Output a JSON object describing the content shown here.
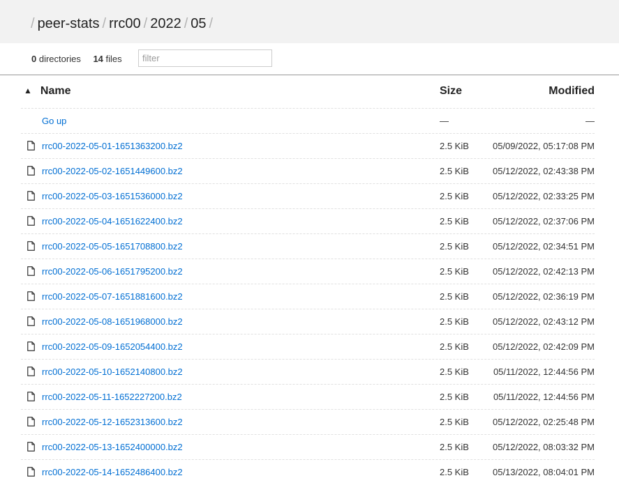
{
  "breadcrumb": {
    "separator": "/",
    "items": [
      "peer-stats",
      "rrc00",
      "2022",
      "05"
    ]
  },
  "summary": {
    "directories_count": "0",
    "directories_label": "directories",
    "files_count": "14",
    "files_label": "files"
  },
  "filter": {
    "placeholder": "filter",
    "value": ""
  },
  "columns": {
    "name": "Name",
    "size": "Size",
    "modified": "Modified",
    "sort_indicator": "▲"
  },
  "go_up": {
    "label": "Go up",
    "size": "—",
    "modified": "—"
  },
  "files": [
    {
      "name": "rrc00-2022-05-01-1651363200.bz2",
      "size": "2.5 KiB",
      "modified": "05/09/2022, 05:17:08 PM"
    },
    {
      "name": "rrc00-2022-05-02-1651449600.bz2",
      "size": "2.5 KiB",
      "modified": "05/12/2022, 02:43:38 PM"
    },
    {
      "name": "rrc00-2022-05-03-1651536000.bz2",
      "size": "2.5 KiB",
      "modified": "05/12/2022, 02:33:25 PM"
    },
    {
      "name": "rrc00-2022-05-04-1651622400.bz2",
      "size": "2.5 KiB",
      "modified": "05/12/2022, 02:37:06 PM"
    },
    {
      "name": "rrc00-2022-05-05-1651708800.bz2",
      "size": "2.5 KiB",
      "modified": "05/12/2022, 02:34:51 PM"
    },
    {
      "name": "rrc00-2022-05-06-1651795200.bz2",
      "size": "2.5 KiB",
      "modified": "05/12/2022, 02:42:13 PM"
    },
    {
      "name": "rrc00-2022-05-07-1651881600.bz2",
      "size": "2.5 KiB",
      "modified": "05/12/2022, 02:36:19 PM"
    },
    {
      "name": "rrc00-2022-05-08-1651968000.bz2",
      "size": "2.5 KiB",
      "modified": "05/12/2022, 02:43:12 PM"
    },
    {
      "name": "rrc00-2022-05-09-1652054400.bz2",
      "size": "2.5 KiB",
      "modified": "05/12/2022, 02:42:09 PM"
    },
    {
      "name": "rrc00-2022-05-10-1652140800.bz2",
      "size": "2.5 KiB",
      "modified": "05/11/2022, 12:44:56 PM"
    },
    {
      "name": "rrc00-2022-05-11-1652227200.bz2",
      "size": "2.5 KiB",
      "modified": "05/11/2022, 12:44:56 PM"
    },
    {
      "name": "rrc00-2022-05-12-1652313600.bz2",
      "size": "2.5 KiB",
      "modified": "05/12/2022, 02:25:48 PM"
    },
    {
      "name": "rrc00-2022-05-13-1652400000.bz2",
      "size": "2.5 KiB",
      "modified": "05/12/2022, 08:03:32 PM"
    },
    {
      "name": "rrc00-2022-05-14-1652486400.bz2",
      "size": "2.5 KiB",
      "modified": "05/13/2022, 08:04:01 PM"
    }
  ],
  "icons": {
    "file": "file-icon",
    "sort": "sort-ascending-icon"
  },
  "colors": {
    "link": "#006ed3",
    "header_bg": "#f2f2f2"
  }
}
